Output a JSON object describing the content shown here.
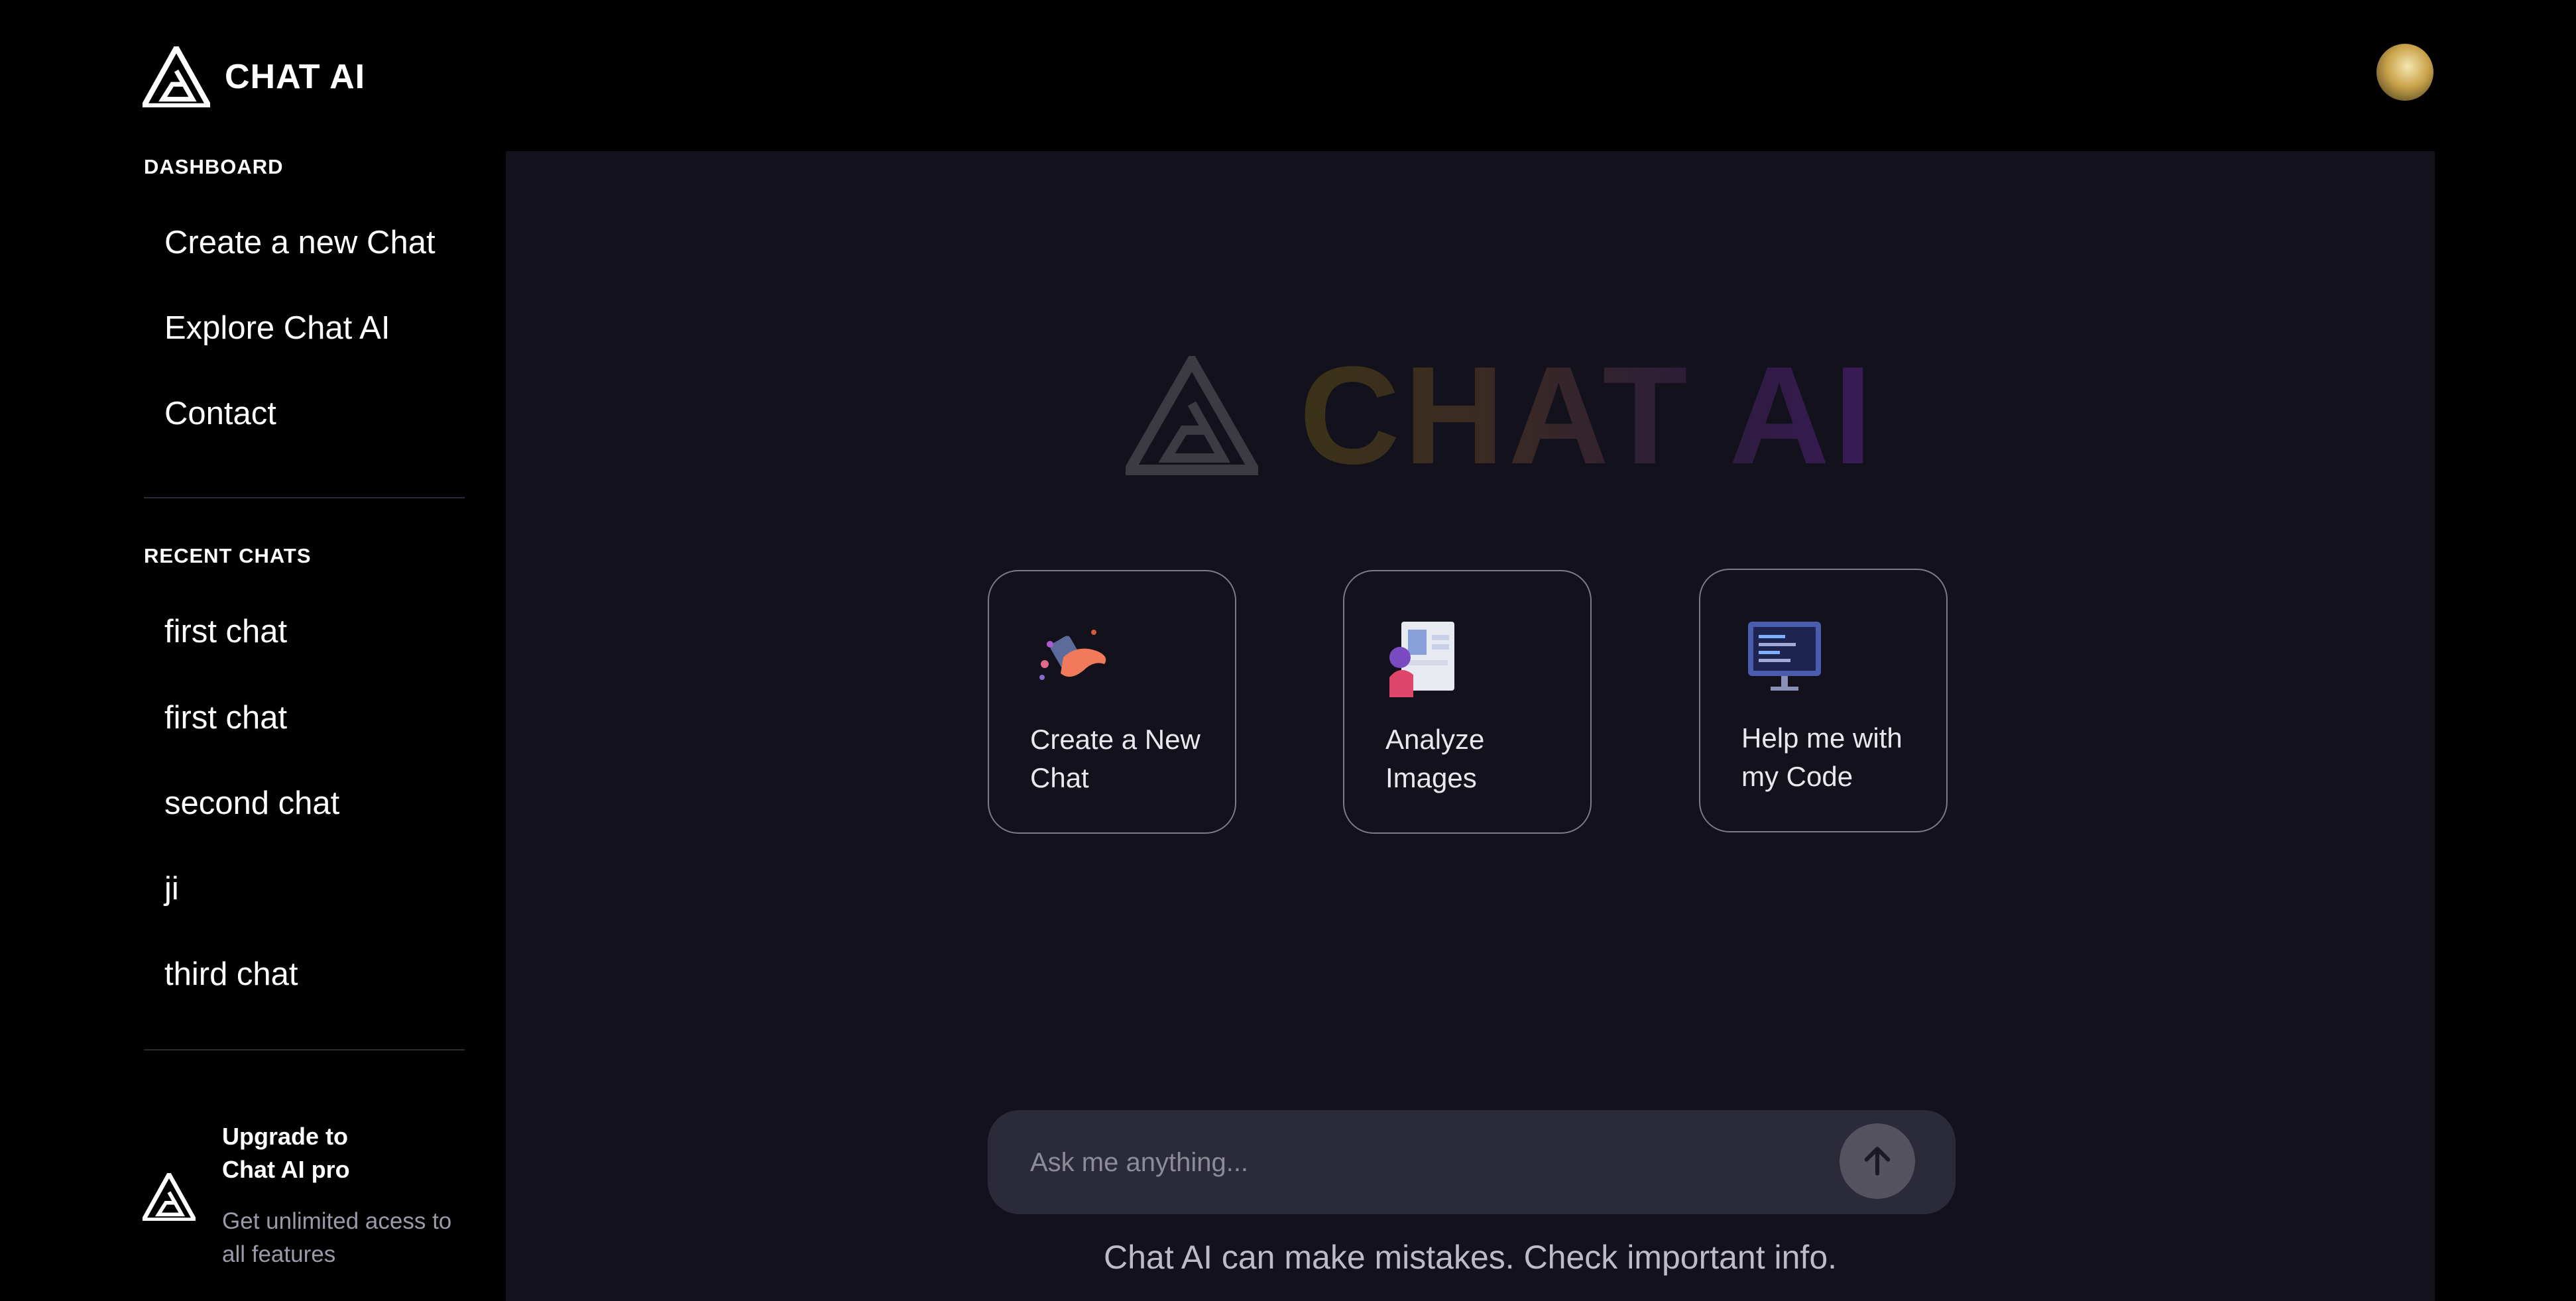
{
  "brand": {
    "name": "CHAT AI"
  },
  "sidebar": {
    "dashboard_title": "DASHBOARD",
    "dashboard_items": [
      {
        "label": "Create a new Chat"
      },
      {
        "label": "Explore Chat AI"
      },
      {
        "label": "Contact"
      }
    ],
    "recent_title": "RECENT CHATS",
    "recent_items": [
      {
        "label": "first chat"
      },
      {
        "label": "first chat"
      },
      {
        "label": "second chat"
      },
      {
        "label": "ji"
      },
      {
        "label": "third chat"
      }
    ],
    "upgrade": {
      "title": "Upgrade to Chat AI pro",
      "description": "Get unlimited acess to all features"
    }
  },
  "main": {
    "hero_title": "CHAT AI",
    "cards": [
      {
        "label": "Create a New Chat",
        "icon": "chat-illustration-icon"
      },
      {
        "label": "Analyze Images",
        "icon": "image-analysis-illustration-icon"
      },
      {
        "label": "Help me with my Code",
        "icon": "code-monitor-illustration-icon"
      }
    ],
    "input": {
      "placeholder": "Ask me anything...",
      "value": ""
    },
    "send_icon": "arrow-up-icon",
    "disclaimer": "Chat AI can make mistakes. Check important info."
  },
  "colors": {
    "background": "#000000",
    "panel": "#12111c",
    "input_bg": "#2b2a38",
    "muted_text": "#9a9aa8"
  }
}
